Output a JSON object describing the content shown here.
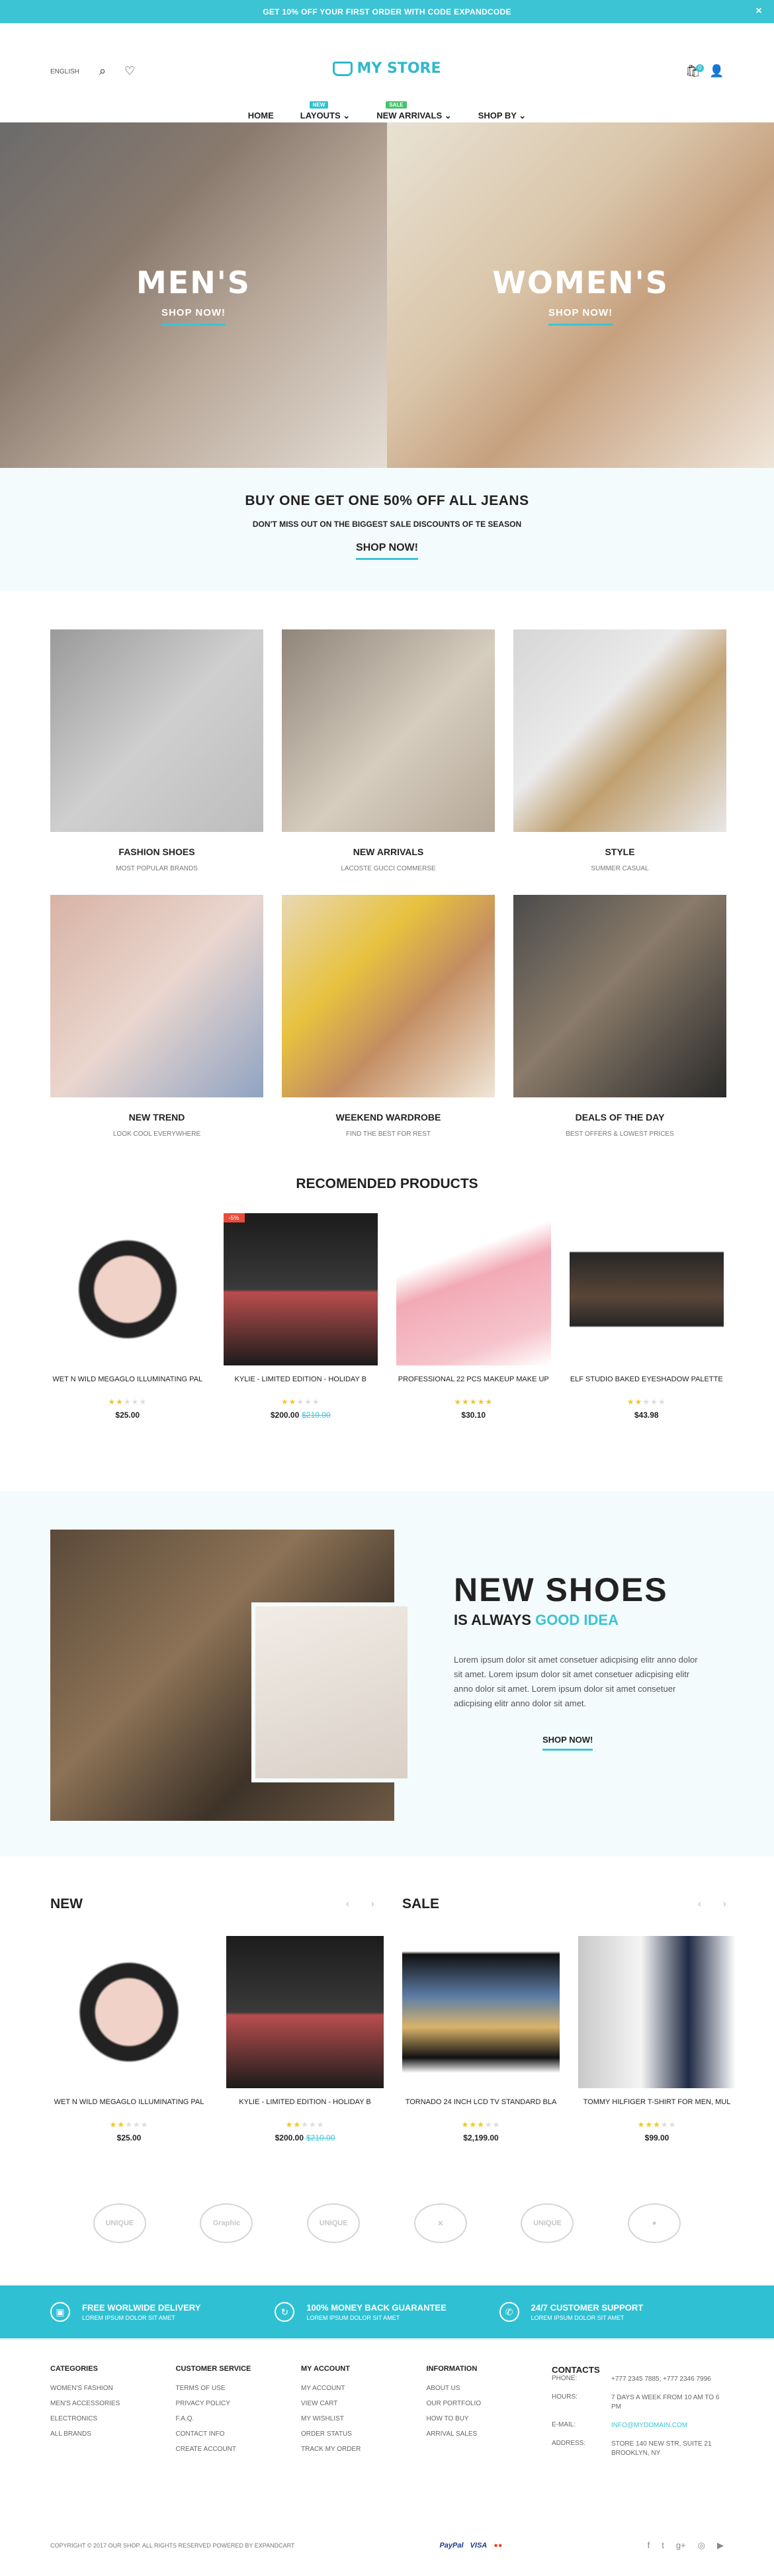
{
  "topbar": {
    "text": "GET 10% OFF YOUR FIRST ORDER WITH CODE EXPANDCODE",
    "close": "×"
  },
  "header": {
    "language": "ENGLISH",
    "logo": "MY STORE",
    "cart_count": "0"
  },
  "nav": [
    {
      "label": "HOME",
      "badge": ""
    },
    {
      "label": "LAYOUTS ⌄",
      "badge": "NEW",
      "badge_color": "#2fc1d3"
    },
    {
      "label": "NEW ARRIVALS ⌄",
      "badge": "SALE",
      "badge_color": "#46c36b"
    },
    {
      "label": "SHOP BY ⌄",
      "badge": ""
    }
  ],
  "hero": {
    "men_title": "MEN'S",
    "men_cta": "SHOP NOW!",
    "women_title": "WOMEN'S",
    "women_cta": "SHOP NOW!"
  },
  "promo": {
    "title": "BUY ONE GET ONE 50% OFF ALL JEANS",
    "subtitle": "DON'T MISS OUT ON THE BIGGEST SALE DISCOUNTS OF TE SEASON",
    "cta": "SHOP NOW!"
  },
  "categories": [
    {
      "title": "FASHION SHOES",
      "sub": "MOST POPULAR BRANDS",
      "bg": "linear-gradient(135deg,#9a9a9a,#cfcfcf 50%,#bdbdbd)"
    },
    {
      "title": "NEW ARRIVALS",
      "sub": "LACOSTE GUCCI COMMERSE",
      "bg": "linear-gradient(135deg,#8f8579,#d6cdbf 55%,#b5a898)"
    },
    {
      "title": "STYLE",
      "sub": "SUMMER CASUAL",
      "bg": "linear-gradient(135deg,#d6d6d6,#eaeaea 40%,#c0a070 60%,#e8e8e8)"
    },
    {
      "title": "NEW TREND",
      "sub": "LOOK COOL EVERYWHERE",
      "bg": "linear-gradient(135deg,#d7b3a5,#ead6ce 50%,#8fa3c2)"
    },
    {
      "title": "WEEKEND WARDROBE",
      "sub": "FIND THE BEST FOR REST",
      "bg": "linear-gradient(135deg,#e8d8b5,#e7c23f 35%,#c38d62 60%,#f0e6d8)"
    },
    {
      "title": "DEALS OF THE DAY",
      "sub": "BEST OFFERS & LOWEST PRICES",
      "bg": "linear-gradient(135deg,#4b4b4b,#8a7b6a 45%,#2a2a2a)"
    }
  ],
  "recommended": {
    "title": "RECOMENDED PRODUCTS",
    "items": [
      {
        "name": "WET N WILD MEGAGLO ILLUMINATING PAL",
        "stars": "★★",
        "off": "★★★",
        "price": "$25.00",
        "old": "",
        "sale": "",
        "bg": "radial-gradient(circle,#f1d2c8 30%,#222 32%,#222 44%,#fff 46%)"
      },
      {
        "name": "KYLIE - LIMITED EDITION - HOLIDAY B",
        "stars": "★★",
        "off": "★★★",
        "price": "$200.00",
        "old": "$210.00",
        "sale": "-5%",
        "bg": "linear-gradient(180deg,#1c1c1c,#3a3a3a 50%,#b94d4d 52%,#1c1c1c)"
      },
      {
        "name": "PROFESSIONAL 22 PCS MAKEUP MAKE UP",
        "stars": "★★★★★",
        "off": "",
        "price": "$30.10",
        "old": "",
        "sale": "",
        "bg": "linear-gradient(160deg,#fff 30%,#f2aab6 45%,#f6c4cc 80%,#fff)"
      },
      {
        "name": "ELF STUDIO BAKED EYESHADOW PALETTE",
        "stars": "★★",
        "off": "★★★",
        "price": "$43.98",
        "old": "",
        "sale": "",
        "bg": "linear-gradient(180deg,#fff 25%,#262626 26%,#5a4638 55%,#262626 74%,#fff 75%)"
      }
    ]
  },
  "newshoes": {
    "title": "NEW SHOES",
    "tag_pre": "IS ALWAYS ",
    "tag_hl": "GOOD IDEA",
    "body": "Lorem ipsum dolor sit amet consetuer adicpising elitr anno dolor sit amet. Lorem ipsum dolor sit amet consetuer adicpising elitr anno dolor sit amet. Lorem ipsum dolor sit amet consetuer adicpising elitr anno dolor sit amet.",
    "cta": "SHOP NOW!"
  },
  "new_section": {
    "title": "NEW",
    "arrows": "‹ ›",
    "items": [
      {
        "name": "WET N WILD MEGAGLO ILLUMINATING PAL",
        "stars": "★★",
        "off": "★★★",
        "price": "$25.00",
        "old": "",
        "bg": "radial-gradient(circle,#f1d2c8 30%,#222 32%,#222 44%,#fff 46%)"
      },
      {
        "name": "KYLIE - LIMITED EDITION - HOLIDAY B",
        "stars": "★★",
        "off": "★★★",
        "price": "$200.00",
        "old": "$210.00",
        "bg": "linear-gradient(180deg,#1c1c1c,#3a3a3a 50%,#b94d4d 52%,#1c1c1c)"
      }
    ]
  },
  "sale_section": {
    "title": "SALE",
    "arrows": "‹ ›",
    "items": [
      {
        "name": "TORNADO 24 INCH LCD TV STANDARD BLA",
        "stars": "★★★",
        "off": "★★",
        "price": "$2,199.00",
        "old": "",
        "bg": "linear-gradient(180deg,#fff 10%,#111 12%,#5d7ea7 40%,#d9b36a 60%,#111 80%,#fff 90%)"
      },
      {
        "name": "TOMMY HILFIGER T-SHIRT FOR MEN, MUL",
        "stars": "★★★",
        "off": "★★",
        "price": "$99.00",
        "old": "",
        "bg": "linear-gradient(90deg,#c8c8c8,#f5f5f5 40%,#1f2a44 70%,#fff)"
      }
    ]
  },
  "brands": [
    "UNIQUE",
    "Graphic",
    "UNIQUE",
    "✕",
    "UNIQUE",
    "●"
  ],
  "features": [
    {
      "icon": "▣",
      "title": "FREE WORLWIDE DELIVERY",
      "sub": "LOREM IPSUM DOLOR SIT AMET"
    },
    {
      "icon": "↻",
      "title": "100% MONEY BACK GUARANTEE",
      "sub": "LOREM IPSUM DOLOR SIT AMET"
    },
    {
      "icon": "✆",
      "title": "24/7 CUSTOMER SUPPORT",
      "sub": "LOREM IPSUM DOLOR SIT AMET"
    }
  ],
  "footer": {
    "categories": {
      "title": "CATEGORIES",
      "links": [
        "WOMEN'S FASHION",
        "MEN'S ACCESSORIES",
        "ELECTRONICS",
        "ALL BRANDS"
      ]
    },
    "service": {
      "title": "CUSTOMER SERVICE",
      "links": [
        "TERMS OF USE",
        "PRIVACY POLICY",
        "F.A.Q.",
        "CONTACT INFO",
        "CREATE ACCOUNT"
      ]
    },
    "account": {
      "title": "MY ACCOUNT",
      "links": [
        "MY ACCOUNT",
        "VIEW CART",
        "MY WISHLIST",
        "ORDER STATUS",
        "TRACK MY ORDER"
      ]
    },
    "info": {
      "title": "INFORMATION",
      "links": [
        "ABOUT US",
        "OUR PORTFOLIO",
        "HOW TO BUY",
        "ARRIVAL SALES"
      ]
    },
    "contacts": {
      "title": "CONTACTS",
      "rows": [
        {
          "k": "PHONE:",
          "v": "+777 2345 7885; +777 2346 7996"
        },
        {
          "k": "HOURS:",
          "v": "7 DAYS A WEEK FROM 10 AM TO 6 PM"
        },
        {
          "k": "E-MAIL:",
          "v": "INFO@MYDOMAIN.COM"
        },
        {
          "k": "ADDRESS:",
          "v": "STORE 140 NEW STR, SUITE 21 BROOKLYN, NY"
        }
      ]
    },
    "copyright": "COPYRIGHT © 2017 OUR SHOP. ALL RIGHTS RESERVED POWERED BY EXPANDCART",
    "payments": [
      "PayPal",
      "VISA",
      "●●"
    ],
    "social": [
      "f",
      "t",
      "g+",
      "◎",
      "▶"
    ]
  }
}
